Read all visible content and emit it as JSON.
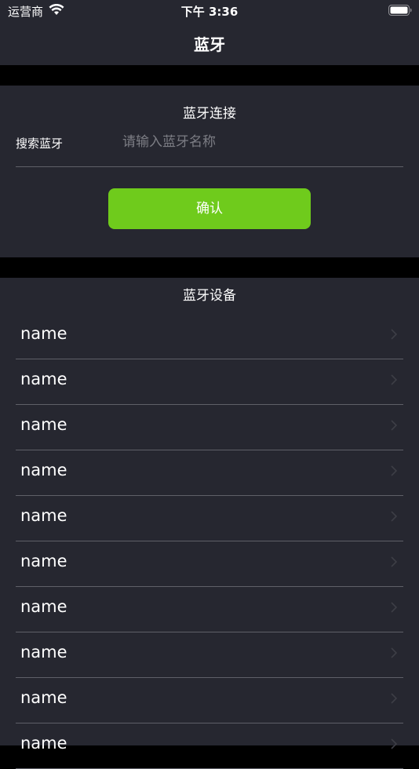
{
  "status_bar": {
    "carrier": "运营商",
    "time": "下午 3:36",
    "wifi_icon": "wifi-icon",
    "battery_icon": "battery-icon"
  },
  "nav": {
    "title": "蓝牙"
  },
  "connect_section": {
    "title": "蓝牙连接",
    "search_label": "搜索蓝牙",
    "search_placeholder": "请输入蓝牙名称",
    "search_value": "",
    "confirm_label": "确认"
  },
  "devices_section": {
    "title": "蓝牙设备",
    "chevron_icon": "chevron-right-icon",
    "items": [
      {
        "name": "name"
      },
      {
        "name": "name"
      },
      {
        "name": "name"
      },
      {
        "name": "name"
      },
      {
        "name": "name"
      },
      {
        "name": "name"
      },
      {
        "name": "name"
      },
      {
        "name": "name"
      },
      {
        "name": "name"
      },
      {
        "name": "name"
      }
    ]
  },
  "colors": {
    "background": "#000000",
    "panel": "#262730",
    "accent": "#6fcb1c",
    "divider": "#5f6068",
    "placeholder": "#7c7d84",
    "chevron": "#3d3e46"
  }
}
